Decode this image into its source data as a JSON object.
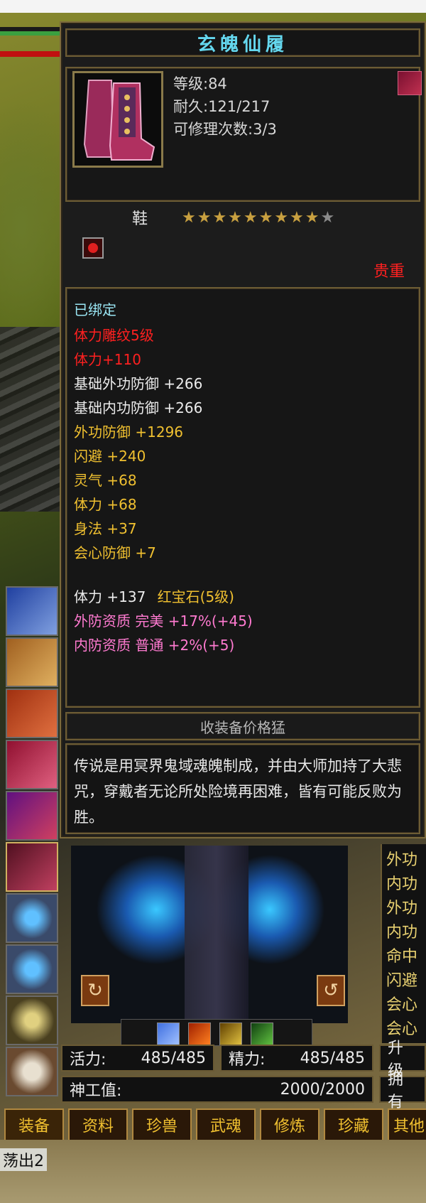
{
  "tooltip": {
    "title": "玄魄仙履",
    "level": "等级:84",
    "durability": "耐久:121/217",
    "repairs": "可修理次数:3/3",
    "slot": "鞋",
    "stars": "★★★★★★★★★",
    "star_empty": "★",
    "rarity": "贵重",
    "bound": "已绑定",
    "attrs": [
      {
        "text": "体力雕纹5级",
        "color": "#ff2020"
      },
      {
        "text": "体力+110",
        "color": "#ff2020"
      },
      {
        "text": "基础外功防御  +266",
        "color": "#ececec"
      },
      {
        "text": "基础内功防御  +266",
        "color": "#ececec"
      },
      {
        "text": "外功防御  +1296",
        "color": "#f0c030"
      },
      {
        "text": "闪避  +240",
        "color": "#f0c030"
      },
      {
        "text": "灵气  +68",
        "color": "#f0c030"
      },
      {
        "text": "体力  +68",
        "color": "#f0c030"
      },
      {
        "text": "身法  +37",
        "color": "#f0c030"
      },
      {
        "text": "会心防御  +7",
        "color": "#f0c030"
      }
    ],
    "gem_line_prefix": "体力  +137",
    "gem_line_gem": "红宝石(5级)",
    "quality_outer": "外防资质    完美  +17%(+45)",
    "quality_inner": "内防资质    普通  +2%(+5)",
    "price": "收装备价格猛",
    "description": "传说是用冥界鬼域魂魄制成，并由大师加持了大悲咒，穿戴者无论所处险境再困难，皆有可能反败为胜。"
  },
  "colors": {
    "title": "#64d7ee",
    "bound": "#9ae6f4",
    "quality": "#ff7ad0",
    "gold": "#f0c030",
    "star_filled": "#c8a040",
    "star_empty": "#8a8a8a"
  },
  "rotate_left_icon": "↻",
  "rotate_right_icon": "↺",
  "stats_col": [
    "外功",
    "内功",
    "外功",
    "内功",
    "命中",
    "闪避",
    "会心",
    "会心"
  ],
  "vitality": {
    "label": "活力:",
    "value": "485/485"
  },
  "energy": {
    "label": "精力:",
    "value": "485/485"
  },
  "upgrade": "升级",
  "shengong": {
    "label": "神工值:",
    "value": "2000/2000"
  },
  "own": "拥有",
  "tabs": [
    "装备",
    "资料",
    "珍兽",
    "武魂",
    "修炼",
    "珍藏",
    "其他"
  ],
  "drift_text": "荡出2"
}
